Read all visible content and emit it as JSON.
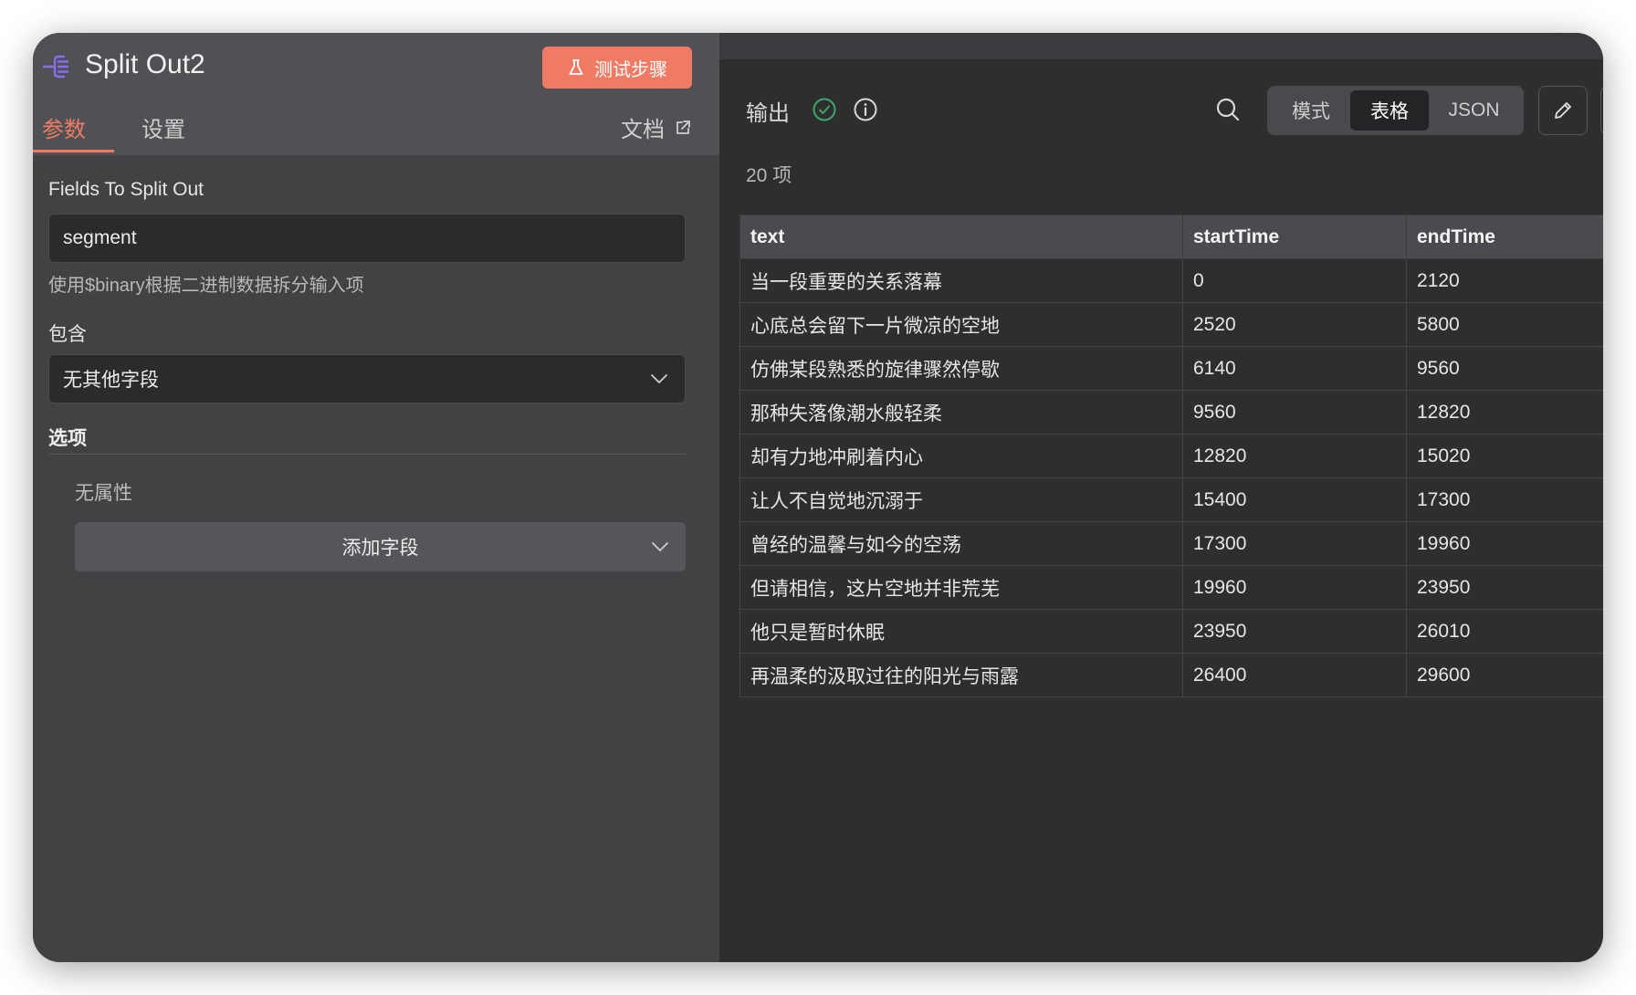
{
  "node": {
    "title": "Split Out2",
    "icon": "split-out-icon",
    "test_button_label": "测试步骤"
  },
  "tabs": [
    {
      "label": "参数",
      "active": true
    },
    {
      "label": "设置",
      "active": false
    }
  ],
  "docs_label": "文档",
  "params": {
    "fields_label": "Fields To Split Out",
    "fields_value": "segment",
    "hint": "使用$binary根据二进制数据拆分输入项",
    "include_label": "包含",
    "include_value": "无其他字段",
    "options_title": "选项",
    "no_properties": "无属性",
    "add_field_label": "添加字段"
  },
  "output": {
    "title": "输出",
    "item_count": "20 项",
    "view_modes": [
      {
        "label": "模式",
        "active": false
      },
      {
        "label": "表格",
        "active": true
      },
      {
        "label": "JSON",
        "active": false
      }
    ],
    "columns": [
      "text",
      "startTime",
      "endTime"
    ],
    "rows": [
      [
        "当一段重要的关系落幕",
        "0",
        "2120"
      ],
      [
        "心底总会留下一片微凉的空地",
        "2520",
        "5800"
      ],
      [
        "仿佛某段熟悉的旋律骤然停歇",
        "6140",
        "9560"
      ],
      [
        "那种失落像潮水般轻柔",
        "9560",
        "12820"
      ],
      [
        "却有力地冲刷着内心",
        "12820",
        "15020"
      ],
      [
        "让人不自觉地沉溺于",
        "15400",
        "17300"
      ],
      [
        "曾经的温馨与如今的空荡",
        "17300",
        "19960"
      ],
      [
        "但请相信，这片空地并非荒芜",
        "19960",
        "23950"
      ],
      [
        "他只是暂时休眠",
        "23950",
        "26010"
      ],
      [
        "再温柔的汲取过往的阳光与雨露",
        "26400",
        "29600"
      ]
    ]
  },
  "colors": {
    "accent": "#ef7b65",
    "success": "#3fa66b",
    "node_icon": "#8b6cf2"
  }
}
